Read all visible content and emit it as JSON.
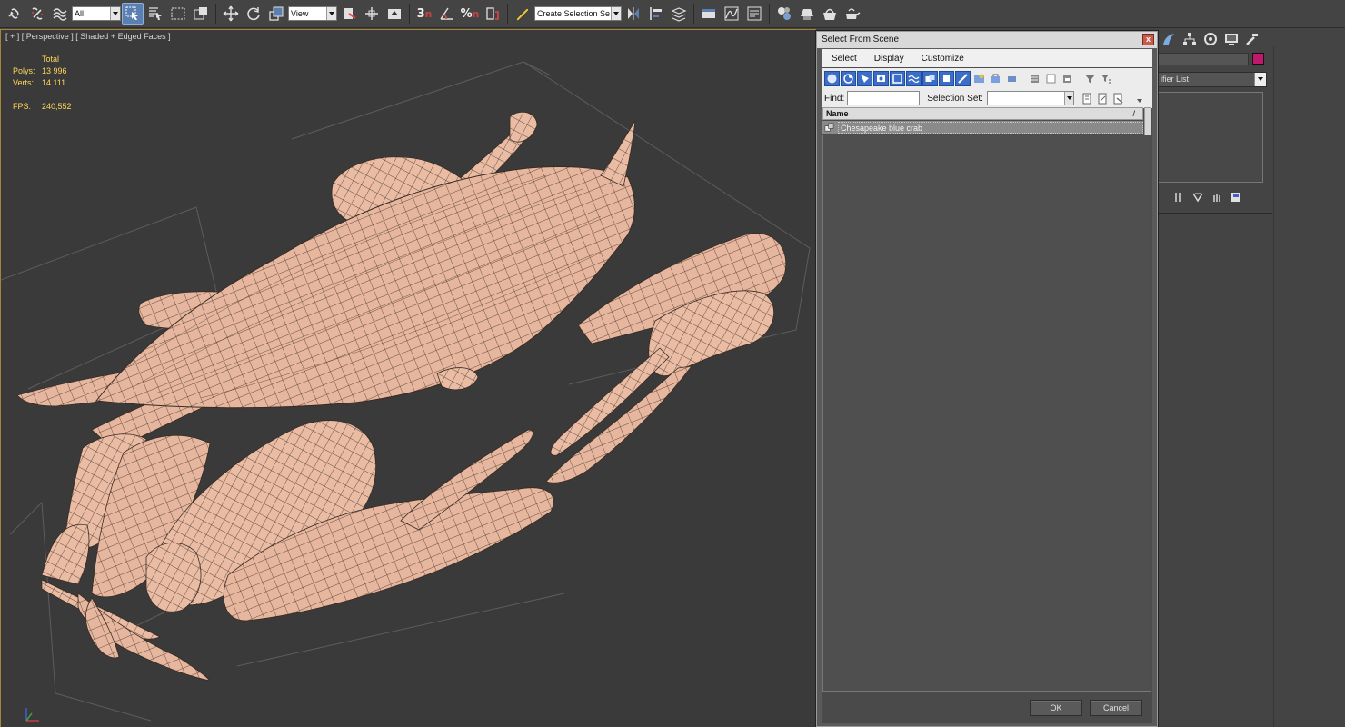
{
  "toolbar": {
    "selection_filter": "All",
    "reference_coord": "View",
    "named_selection_placeholder": "Create Selection Se",
    "snap_label": "3",
    "percent_snap_label": "%"
  },
  "viewport": {
    "label": "[ + ] [ Perspective ] [ Shaded + Edged Faces ]",
    "stats": {
      "header": "Total",
      "polys_label": "Polys:",
      "polys_value": "13 996",
      "verts_label": "Verts:",
      "verts_value": "14 111",
      "fps_label": "FPS:",
      "fps_value": "240,552"
    }
  },
  "command_panel": {
    "modifier_list": "ifier List",
    "object_color": "#c2186c"
  },
  "dialog": {
    "title": "Select From Scene",
    "close_glyph": "x",
    "menus": [
      {
        "label": "Select"
      },
      {
        "label": "Display"
      },
      {
        "label": "Customize"
      }
    ],
    "find_label": "Find:",
    "find_value": "",
    "selection_set_label": "Selection Set:",
    "selection_set_value": "",
    "list_header": "Name",
    "sort_indicator": "/",
    "rows": [
      {
        "name": "Chesapeake blue crab",
        "icon": "group-icon",
        "selected": true
      }
    ],
    "ok_label": "OK",
    "cancel_label": "Cancel"
  },
  "colors": {
    "viewport_bg": "#3a3a3a",
    "active_border": "#a6853a",
    "crab_fill": "#e8b9a0",
    "wire": "#3a2a22",
    "stats_text": "#ffd75a",
    "ui_bg": "#444444",
    "highlight": "#5a7fb0"
  }
}
